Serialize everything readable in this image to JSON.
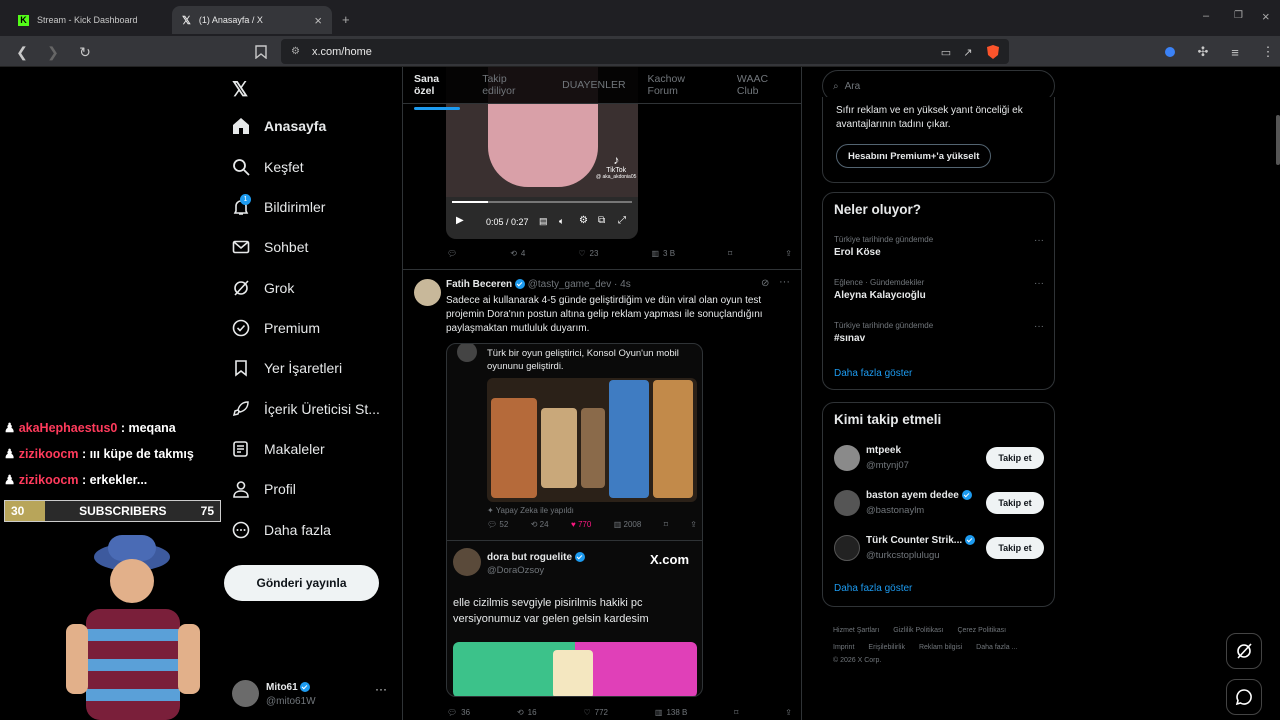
{
  "browser": {
    "tabs": [
      {
        "title": "Stream - Kick Dashboard"
      },
      {
        "title": "(1) Anasayfa / X"
      }
    ],
    "url": "x.com/home"
  },
  "nav": {
    "items": [
      {
        "label": "Anasayfa"
      },
      {
        "label": "Keşfet"
      },
      {
        "label": "Bildirimler",
        "badge": "1"
      },
      {
        "label": "Sohbet"
      },
      {
        "label": "Grok"
      },
      {
        "label": "Premium"
      },
      {
        "label": "Yer İşaretleri"
      },
      {
        "label": "İçerik Üreticisi St..."
      },
      {
        "label": "Makaleler"
      },
      {
        "label": "Profil"
      },
      {
        "label": "Daha fazla"
      }
    ],
    "post_button": "Gönderi yayınla",
    "account": {
      "name": "Mito61",
      "handle": "@mito61W"
    }
  },
  "timeline": {
    "tabs": [
      "Sana özel",
      "Takip ediliyor",
      "DUAYENLER",
      "Kachow Forum",
      "WAAC Club"
    ],
    "video": {
      "time": "0:05 / 0:27",
      "watermark_name": "TikTok",
      "watermark_handle": "@ aka_akdonia05"
    },
    "post1_actions": {
      "reposts": "4",
      "likes": "23",
      "views": "3 B"
    },
    "post2": {
      "author": "Fatih Beceren",
      "handle": "@tasty_game_dev",
      "time": "4s",
      "text": "Sadece ai kullanarak 4-5 günde geliştirdiğim ve dün viral olan oyun test projemin Dora'nın postun altına gelip reklam yapması ile sonuçlandığını paylaşmaktan mutluluk duyarım.",
      "quote": {
        "text": "Türk bir oyun geliştirici, Konsol Oyun'un mobil oyununu geliştirdi.",
        "ai_label": "Yapay Zeka ile yapıldı",
        "replies": "52",
        "reposts": "24",
        "likes": "770",
        "views": "2008"
      },
      "embed": {
        "name": "dora but roguelite",
        "handle": "@DoraOzsoy",
        "logo": "X.com",
        "text": "elle cizilmis sevgiyle pisirilmis hakiki pc versiyonumuz var gelen gelsin kardesim"
      },
      "actions": {
        "replies": "36",
        "reposts": "16",
        "likes": "772",
        "views": "138 B"
      }
    }
  },
  "sidebar": {
    "search_placeholder": "Ara",
    "premium_text": "Sıfır reklam ve en yüksek yanıt önceliği ek avantajlarının tadını çıkar.",
    "premium_button": "Hesabını Premium+'a yükselt",
    "trends_title": "Neler oluyor?",
    "trends": [
      {
        "meta": "Türkiye tarihinde gündemde",
        "name": "Erol Köse"
      },
      {
        "meta": "Eğlence · Gündemdekiler",
        "name": "Aleyna Kalaycıoğlu"
      },
      {
        "meta": "Türkiye tarihinde gündemde",
        "name": "#sınav"
      }
    ],
    "show_more": "Daha fazla göster",
    "who_title": "Kimi takip etmeli",
    "who": [
      {
        "name": "mtpeek",
        "handle": "@mtynj07"
      },
      {
        "name": "baston ayem dedee",
        "handle": "@bastonaylm"
      },
      {
        "name": "Türk Counter Strik...",
        "handle": "@turkcstoplulugu"
      }
    ],
    "follow_label": "Takip et",
    "who_more": "Daha fazla göster",
    "footer_row1": [
      "Hizmet Şartları",
      "Gizlilik Politikası",
      "Çerez Politikası"
    ],
    "footer_row2": [
      "Imprint",
      "Erişilebilirlik",
      "Reklam bilgisi",
      "Daha fazla ..."
    ],
    "copyright": "© 2026 X Corp."
  },
  "overlay": {
    "chat": [
      {
        "user": "akaHephaestus0",
        "msg": ": meqana"
      },
      {
        "user": "zizikoocm",
        "msg": ": ııı küpe de takmış"
      },
      {
        "user": "zizikoocm",
        "msg": ": erkekler..."
      }
    ],
    "subs_left": "30",
    "subs_label": "SUBSCRIBERS",
    "subs_right": "75"
  }
}
